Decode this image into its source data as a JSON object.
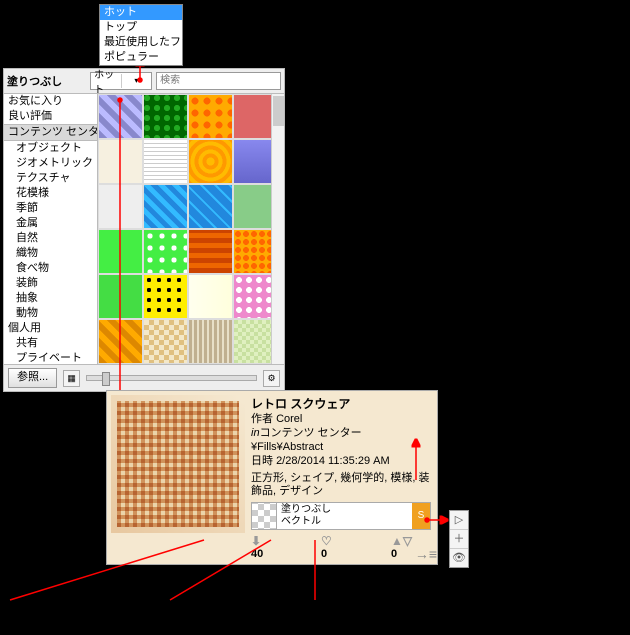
{
  "dropdown": {
    "items": [
      "ホット",
      "トップ",
      "最近使用したファイル",
      "ポピュラー"
    ],
    "selected_index": 0
  },
  "dialog": {
    "title": "塗りつぶし",
    "combo_value": "ホット",
    "search_placeholder": "検索",
    "tree": [
      {
        "label": "お気に入り",
        "indent": 0,
        "selected": false
      },
      {
        "label": "良い評価",
        "indent": 0,
        "selected": false
      },
      {
        "label": "コンテンツ センター",
        "indent": 0,
        "selected": true
      },
      {
        "label": "オブジェクト",
        "indent": 1,
        "selected": false
      },
      {
        "label": "ジオメトリック",
        "indent": 1,
        "selected": false
      },
      {
        "label": "テクスチャ",
        "indent": 1,
        "selected": false
      },
      {
        "label": "花模様",
        "indent": 1,
        "selected": false
      },
      {
        "label": "季節",
        "indent": 1,
        "selected": false
      },
      {
        "label": "金属",
        "indent": 1,
        "selected": false
      },
      {
        "label": "自然",
        "indent": 1,
        "selected": false
      },
      {
        "label": "織物",
        "indent": 1,
        "selected": false
      },
      {
        "label": "食べ物",
        "indent": 1,
        "selected": false
      },
      {
        "label": "装飾",
        "indent": 1,
        "selected": false
      },
      {
        "label": "抽象",
        "indent": 1,
        "selected": false
      },
      {
        "label": "動物",
        "indent": 1,
        "selected": false
      },
      {
        "label": "個人用",
        "indent": 0,
        "selected": false
      },
      {
        "label": "共有",
        "indent": 1,
        "selected": false
      },
      {
        "label": "プライベート",
        "indent": 1,
        "selected": false
      }
    ],
    "swatches": [
      {
        "bg": "repeating-linear-gradient(45deg,#88c 0 6px,#bbf 6px 12px)"
      },
      {
        "bg": "radial-gradient(circle at 30% 30%,#2a2 30%,#060 32%) 0 0/10px 10px"
      },
      {
        "bg": "radial-gradient(circle,#f60 40%,#fa0 42%) 0 0/12px 12px,#f80"
      },
      {
        "bg": "linear-gradient(90deg,#d66,#d66)"
      },
      {
        "bg": "#f6f0e0"
      },
      {
        "bg": "repeating-linear-gradient(0deg,#fff 0 3px,#ccc 3px 4px),repeating-linear-gradient(90deg,#fff 0 3px,#ccc 3px 4px)"
      },
      {
        "bg": "repeating-radial-gradient(#fb0 0 4px,#f90 4px 8px)"
      },
      {
        "bg": "linear-gradient(#88e,#66c)"
      },
      {
        "bg": "#eee"
      },
      {
        "bg": "repeating-linear-gradient(45deg,#3bf 0 5px,#28d 5px 10px)"
      },
      {
        "bg": "repeating-linear-gradient(45deg,#28d 0 8px,#3bf 8px 10px)"
      },
      {
        "bg": "#8c8"
      },
      {
        "bg": "#4e4"
      },
      {
        "bg": "radial-gradient(circle,#fff 30%,#4e4 32%) 0 0/12px 12px,#4e4"
      },
      {
        "bg": "repeating-linear-gradient(0deg,#c40 0 5px,#e60 5px 10px)"
      },
      {
        "bg": "radial-gradient(#f60 0 3px,#fa0 3px 6px) 0 0/8px 8px"
      },
      {
        "bg": "#4d4"
      },
      {
        "bg": "radial-gradient(circle,#000 30%,#fe0 32%) 0 0/10px 10px,#fe0"
      },
      {
        "bg": "linear-gradient(90deg,#ffe,#ffd)"
      },
      {
        "bg": "radial-gradient(#fff 0 3px,#e8c 3px) 0 0/10px 10px,#e8c"
      },
      {
        "bg": "repeating-linear-gradient(45deg,#d80 0 6px,#fa0 6px 12px)"
      },
      {
        "bg": "repeating-conic-gradient(#e0c080 0 25%,#f4e8c8 0 50%) 0 0/10px 10px"
      },
      {
        "bg": "repeating-linear-gradient(90deg,#c0b090 0 3px,#e8e0c8 3px 5px)"
      },
      {
        "bg": "repeating-conic-gradient(#e0f0c0 0 25%,#c8e0a0 0 50%) 0 0/8px 8px"
      }
    ],
    "browse_label": "参照..."
  },
  "card": {
    "title": "レトロ スクウェア",
    "author_prefix": "作者 ",
    "author": "Corel",
    "path_prefix": "in",
    "path": "コンテンツ センター¥Fills¥Abstract",
    "date_prefix": "日時 ",
    "date": "2/28/2014 11:35:29 AM",
    "tags": "正方形, シェイプ, 幾何学的, 模様, 装飾品, デザイン",
    "fill_label1": "塗りつぶし",
    "fill_label2": "ベクトル",
    "stats": {
      "download_label": "40",
      "favorite_label": "0",
      "vote_label": "0"
    }
  },
  "sidebar_icons": [
    "▷",
    "＋",
    "👁"
  ]
}
